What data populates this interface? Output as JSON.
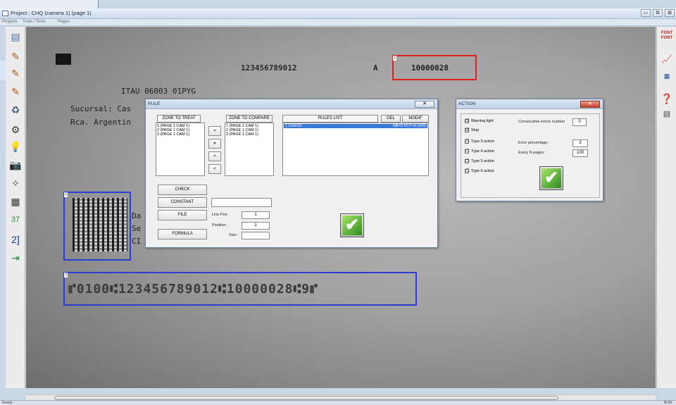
{
  "window": {
    "title": "Project : CHQ (camera 1) (page 1)",
    "min_label": "▭",
    "max_label": "⧉",
    "close_label": "⊠"
  },
  "menu": [
    "Projects",
    "Tools / Tests",
    "Pages"
  ],
  "document": {
    "micr_top": "123456789012",
    "letter": "A",
    "amount": "10000028",
    "bank": "ITAU 06003 01PYG",
    "line1": "Sucursal: Cas",
    "line2": "Rca. Argentin",
    "side1": "Da",
    "side2": "Se",
    "side3": "CI",
    "micr_bottom": "⑈0100⑆123456789012⑆10000028⑆9⑈",
    "zone_labels": [
      "1",
      "2",
      "3"
    ]
  },
  "rule_dialog": {
    "title": "RULE",
    "close_label": "✕",
    "zone_to_treat_header": "ZONE TO TREAT",
    "zone_to_compare_header": "ZONE TO COMPARE",
    "rules_list_header": "RULES LIST",
    "del_label": "DEL",
    "modif_label": "MODIF",
    "zones_treat": [
      "1 (PAGE 1 CAM 1)",
      "2 (PAGE 1 CAM 1)",
      "3 (PAGE 1 CAM 1)"
    ],
    "zones_compare": [
      "1 (PAGE 1 CAM 1)",
      "2 (PAGE 1 CAM 1)",
      "3 (PAGE 1 CAM 1)"
    ],
    "rules": [
      {
        "name": "1 CHECK",
        "detail": "NB=0 PCT=0 (100)"
      }
    ],
    "op_buttons": [
      "=",
      "≠",
      ">",
      "<"
    ],
    "check_label": "CHECK",
    "constant_label": "CONSTANT",
    "constant_value": "",
    "file_label": "FILE",
    "formula_label": "FORMULA",
    "line_pos_label": "Line Pos :",
    "line_pos_value": "1",
    "position_label": "Position :",
    "position_value": "1",
    "size_label": "Size :",
    "size_value": ""
  },
  "action_dialog": {
    "title": "ACTION",
    "close_label": "✕",
    "checkboxes": [
      {
        "label": "Warning light",
        "checked": "☑"
      },
      {
        "label": "Stop",
        "checked": "☑"
      },
      {
        "label": "Type 3 action",
        "checked": "☐"
      },
      {
        "label": "Type 4 action",
        "checked": "☐"
      },
      {
        "label": "Type 5 action",
        "checked": "☐"
      },
      {
        "label": "Type 6 action",
        "checked": "☐"
      }
    ],
    "consecutive_label": "Consecutive errors number",
    "consecutive_value": "0",
    "error_pct_label": "Error percentage :",
    "error_pct_value": "3",
    "every_n_label": "Every N pages :",
    "every_n_value": "100"
  },
  "ok_glyph": "✔",
  "colors": {
    "zone1": "#e0201e",
    "zone_blue": "#2a3fd1"
  },
  "status": {
    "left": "Ready",
    "right": "NUM"
  }
}
